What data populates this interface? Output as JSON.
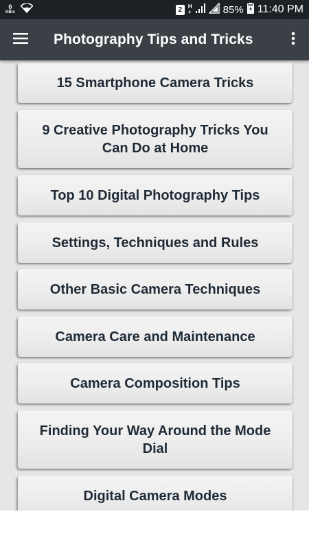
{
  "status_bar": {
    "net_speed_value": "0",
    "net_speed_unit": "KB/s",
    "sim_slot": "2",
    "network_type_top": "H",
    "network_type_bottom": "+",
    "battery_percent": "85%",
    "time": "11:40 PM"
  },
  "app_bar": {
    "title": "Photography Tips and Tricks",
    "menu_icon": "hamburger-menu-icon",
    "overflow_icon": "more-vertical-icon"
  },
  "list": {
    "items": [
      {
        "label": "15 Smartphone Camera Tricks"
      },
      {
        "label": "9 Creative Photography Tricks You Can Do at Home"
      },
      {
        "label": "Top 10 Digital Photography Tips"
      },
      {
        "label": "Settings, Techniques and Rules"
      },
      {
        "label": "Other Basic Camera Techniques"
      },
      {
        "label": "Camera Care and Maintenance"
      },
      {
        "label": "Camera Composition Tips"
      },
      {
        "label": "Finding Your Way Around the Mode Dial"
      },
      {
        "label": "Digital Camera Modes"
      }
    ]
  },
  "colors": {
    "status_bar_bg": "#1c2125",
    "app_bar_bg": "#3a4046",
    "page_bg": "#e6e6e6",
    "item_text": "#1f2a35"
  }
}
